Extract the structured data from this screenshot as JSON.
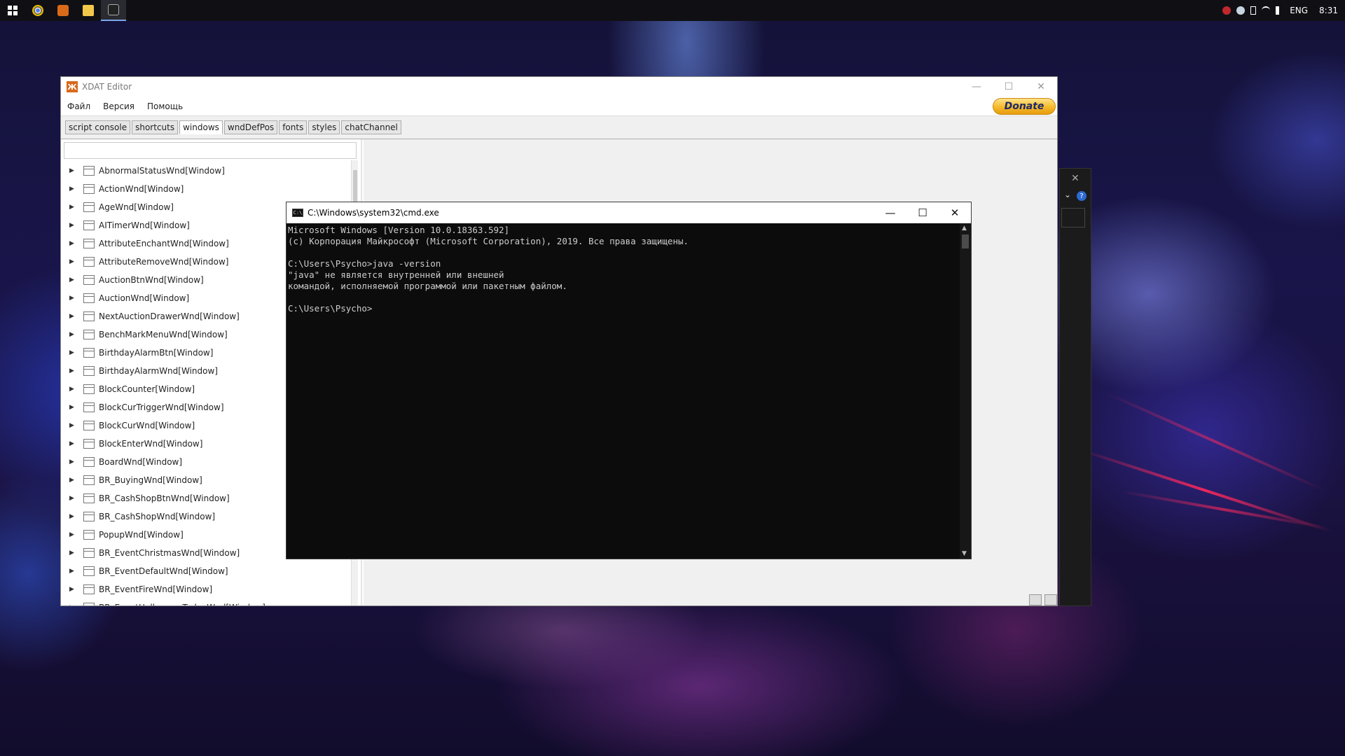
{
  "taskbar": {
    "apps": [
      {
        "name": "chrome",
        "color": "#3a9a3c"
      },
      {
        "name": "xdat-editor",
        "color": "#d86a1a"
      },
      {
        "name": "file-explorer",
        "color": "#f2c84b"
      },
      {
        "name": "cmd",
        "color": "#444444"
      }
    ],
    "language": "ENG",
    "clock": "8:31"
  },
  "xdat": {
    "title": "XDAT Editor",
    "menu": [
      "Файл",
      "Версия",
      "Помощь"
    ],
    "donate_label": "Donate",
    "tabs": [
      "script console",
      "shortcuts",
      "windows",
      "wndDefPos",
      "fonts",
      "styles",
      "chatChannel"
    ],
    "active_tab": "windows",
    "filter_value": "",
    "tree": [
      "AbnormalStatusWnd[Window]",
      "ActionWnd[Window]",
      "AgeWnd[Window]",
      "AITimerWnd[Window]",
      "AttributeEnchantWnd[Window]",
      "AttributeRemoveWnd[Window]",
      "AuctionBtnWnd[Window]",
      "AuctionWnd[Window]",
      "NextAuctionDrawerWnd[Window]",
      "BenchMarkMenuWnd[Window]",
      "BirthdayAlarmBtn[Window]",
      "BirthdayAlarmWnd[Window]",
      "BlockCounter[Window]",
      "BlockCurTriggerWnd[Window]",
      "BlockCurWnd[Window]",
      "BlockEnterWnd[Window]",
      "BoardWnd[Window]",
      "BR_BuyingWnd[Window]",
      "BR_CashShopBtnWnd[Window]",
      "BR_CashShopWnd[Window]",
      "PopupWnd[Window]",
      "BR_EventChristmasWnd[Window]",
      "BR_EventDefaultWnd[Window]",
      "BR_EventFireWnd[Window]",
      "BR_EventHalloweenTodayWnd[Window]"
    ]
  },
  "cmd": {
    "title": "C:\\Windows\\system32\\cmd.exe",
    "icon_text": "C:\\",
    "lines": [
      "Microsoft Windows [Version 10.0.18363.592]",
      "(c) Корпорация Майкрософт (Microsoft Corporation), 2019. Все права защищены.",
      "",
      "C:\\Users\\Psycho>java -version",
      "\"java\" не является внутренней или внешней",
      "командой, исполняемой программой или пакетным файлом.",
      "",
      "C:\\Users\\Psycho>"
    ]
  }
}
